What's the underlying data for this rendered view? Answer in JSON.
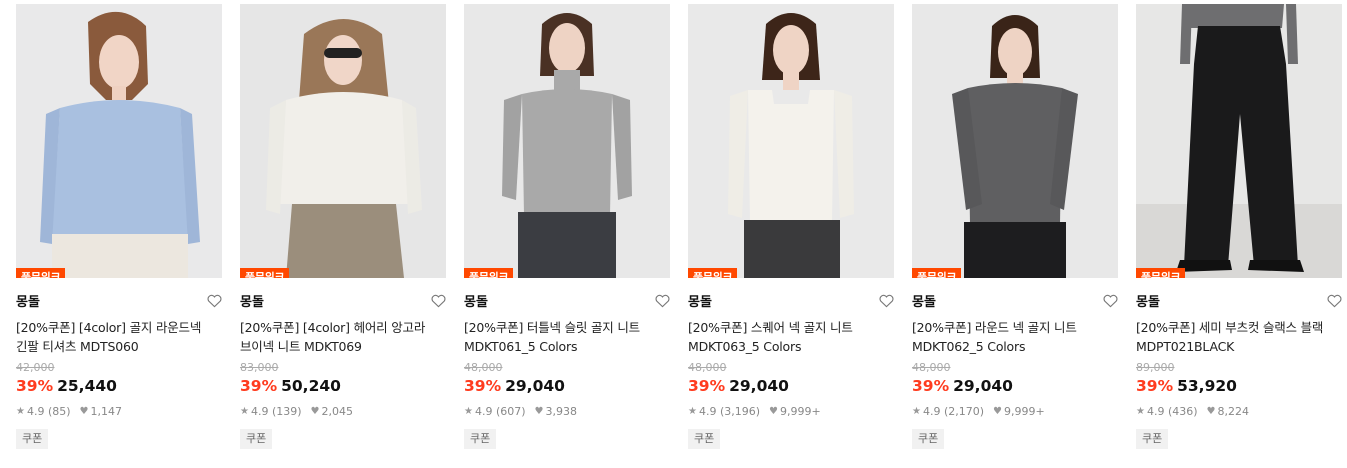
{
  "colors": {
    "badge": "#ff4800",
    "discount": "#ff3c1f"
  },
  "products": [
    {
      "badge": "풀문위크",
      "brand": "몽돌",
      "name_line1": "[20%쿠폰] [4color] 골지 라운드넥",
      "name_line2": "긴팔 티셔츠 MDTS060",
      "original_price": "42,000",
      "discount": "39%",
      "price": "25,440",
      "rating": "4.9 (85)",
      "likes": "1,147",
      "coupon": "쿠폰",
      "image": {
        "top": "#a9c0e0",
        "bottom": "#ece7df",
        "bg": "#e9e9ea",
        "hair": "#8a5a3c"
      }
    },
    {
      "badge": "풀문위크",
      "brand": "몽돌",
      "name_line1": "[20%쿠폰] [4color] 헤어리 앙고라",
      "name_line2": "브이넥 니트 MDKT069",
      "original_price": "83,000",
      "discount": "39%",
      "price": "50,240",
      "rating": "4.9 (139)",
      "likes": "2,045",
      "coupon": "쿠폰",
      "image": {
        "top": "#f1efea",
        "bottom": "#9b8e7c",
        "bg": "#e6e6e6",
        "hair": "#9a7758"
      }
    },
    {
      "badge": "풀문위크",
      "brand": "몽돌",
      "name_line1": "[20%쿠폰] 터틀넥 슬릿 골지 니트",
      "name_line2": "MDKT061_5 Colors",
      "original_price": "48,000",
      "discount": "39%",
      "price": "29,040",
      "rating": "4.9 (607)",
      "likes": "3,938",
      "coupon": "쿠폰",
      "image": {
        "top": "#a9a9a9",
        "bottom": "#3b3d42",
        "bg": "#e8e8e8",
        "hair": "#4a3124"
      }
    },
    {
      "badge": "풀문위크",
      "brand": "몽돌",
      "name_line1": "[20%쿠폰] 스퀘어 넥 골지 니트",
      "name_line2": "MDKT063_5 Colors",
      "original_price": "48,000",
      "discount": "39%",
      "price": "29,040",
      "rating": "4.9 (3,196)",
      "likes": "9,999+",
      "coupon": "쿠폰",
      "image": {
        "top": "#f4f2ec",
        "bottom": "#3a3a3c",
        "bg": "#e9e9e9",
        "hair": "#3d2519"
      }
    },
    {
      "badge": "풀문위크",
      "brand": "몽돌",
      "name_line1": "[20%쿠폰] 라운드 넥 골지 니트",
      "name_line2": "MDKT062_5 Colors",
      "original_price": "48,000",
      "discount": "39%",
      "price": "29,040",
      "rating": "4.9 (2,170)",
      "likes": "9,999+",
      "coupon": "쿠폰",
      "image": {
        "top": "#5f5f61",
        "bottom": "#1d1d1f",
        "bg": "#e8e8e8",
        "hair": "#3a2418"
      }
    },
    {
      "badge": "풀문위크",
      "brand": "몽돌",
      "name_line1": "[20%쿠폰] 세미 부츠컷 슬랙스 블랙",
      "name_line2": "MDPT021BLACK",
      "original_price": "89,000",
      "discount": "39%",
      "price": "53,920",
      "rating": "4.9 (436)",
      "likes": "8,224",
      "coupon": "쿠폰",
      "image": {
        "top": "#6e6e70",
        "bottom": "#1a1a1b",
        "bg": "#e7e7e6",
        "hair": "#3a2418"
      }
    }
  ]
}
